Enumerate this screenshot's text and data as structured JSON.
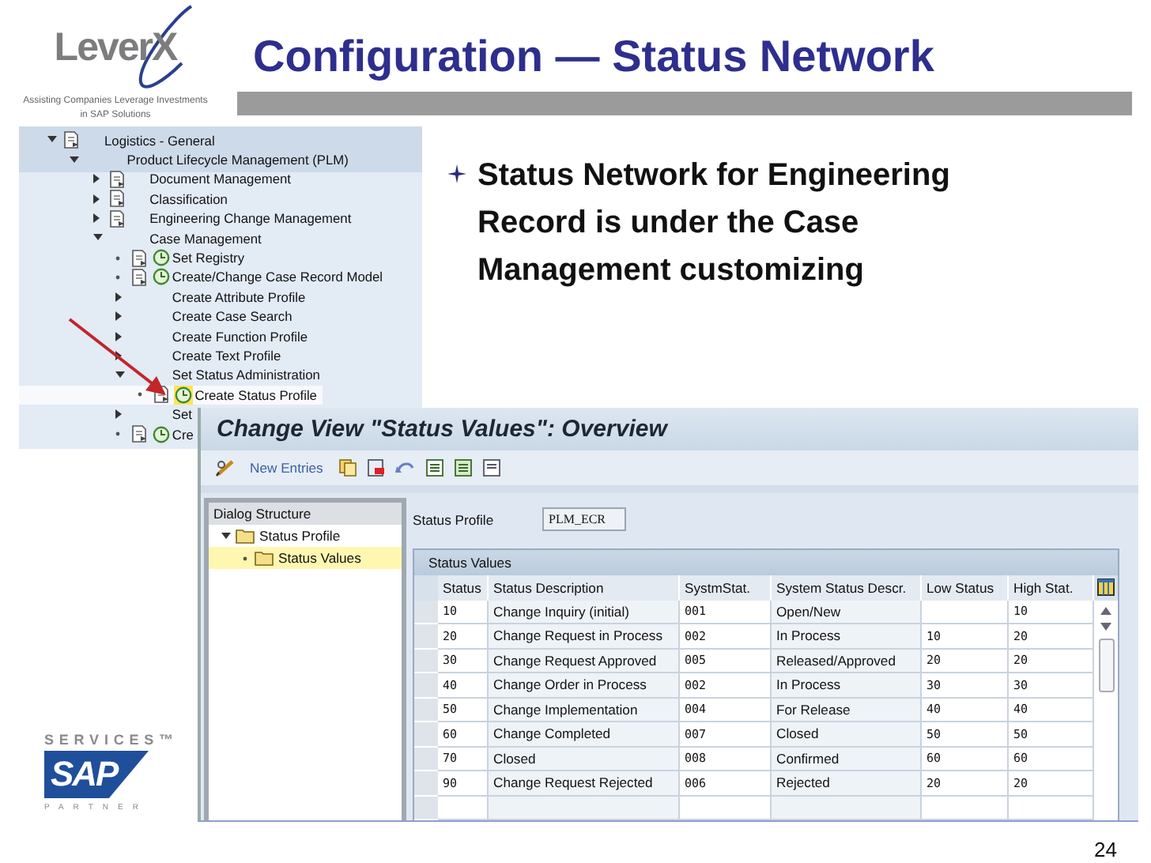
{
  "header": {
    "logo_text": "LeverX",
    "tagline": "Assisting Companies Leverage Investments in SAP Solutions",
    "title": "Configuration — Status Network"
  },
  "img_tree": {
    "items": [
      {
        "label": "Logistics - General",
        "kind": "doc",
        "expanded": true,
        "selected": false,
        "children": [
          {
            "label": "Product Lifecycle Management (PLM)",
            "kind": "plain",
            "expanded": true,
            "selected": false,
            "children": [
              {
                "label": "Document Management",
                "kind": "doc",
                "expanded": false,
                "selected": false
              },
              {
                "label": "Classification",
                "kind": "doc",
                "expanded": false,
                "selected": false
              },
              {
                "label": "Engineering Change Management",
                "kind": "doc",
                "expanded": false,
                "selected": false
              },
              {
                "label": "Case Management",
                "kind": "plain",
                "expanded": true,
                "selected": false,
                "children": [
                  {
                    "label": "Set Registry",
                    "kind": "doc_exec",
                    "expanded": false,
                    "selected": false
                  },
                  {
                    "label": "Create/Change Case Record Model",
                    "kind": "doc_exec",
                    "expanded": false,
                    "selected": false
                  },
                  {
                    "label": "Create Attribute Profile",
                    "kind": "plain",
                    "expanded": false,
                    "selected": false
                  },
                  {
                    "label": "Create Case Search",
                    "kind": "plain",
                    "expanded": false,
                    "selected": false
                  },
                  {
                    "label": "Create Function Profile",
                    "kind": "plain",
                    "expanded": false,
                    "selected": false
                  },
                  {
                    "label": "Create Text Profile",
                    "kind": "plain",
                    "expanded": false,
                    "selected": false
                  },
                  {
                    "label": "Set Status Administration",
                    "kind": "plain",
                    "expanded": true,
                    "selected": false,
                    "children": [
                      {
                        "label": "Create Status Profile",
                        "kind": "doc_exec",
                        "expanded": false,
                        "selected": true
                      }
                    ]
                  },
                  {
                    "label": "Set",
                    "kind": "plain",
                    "expanded": false,
                    "selected": false
                  },
                  {
                    "label": "Cre",
                    "kind": "doc_exec",
                    "expanded": false,
                    "selected": false
                  }
                ]
              }
            ]
          }
        ]
      }
    ]
  },
  "bullets": [
    "Status Network for Engineering Record is under the Case Management customizing"
  ],
  "sap_window": {
    "title": "Change View \"Status Values\": Overview",
    "toolbar": {
      "new_entries": "New Entries"
    },
    "dialog_structure": {
      "heading": "Dialog Structure",
      "items": [
        {
          "label": "Status Profile",
          "expanded": true,
          "selected": false,
          "children": [
            {
              "label": "Status Values",
              "expanded": false,
              "selected": true
            }
          ]
        }
      ]
    },
    "status_profile": {
      "label": "Status Profile",
      "value": "PLM_ECR"
    },
    "table": {
      "title": "Status Values",
      "columns": [
        "Status",
        "Status Description",
        "SystmStat.",
        "System Status Descr.",
        "Low Status",
        "High Stat."
      ],
      "rows": [
        {
          "status": "10",
          "description": "Change Inquiry (initial)",
          "system_status": "001",
          "system_status_descr": "Open/New",
          "high_status": "10"
        },
        {
          "status": "20",
          "description": "Change Request in Process",
          "system_status": "002",
          "system_status_descr": "In Process",
          "low_status": "10",
          "high_status": "20"
        },
        {
          "status": "30",
          "description": "Change Request Approved",
          "system_status": "005",
          "system_status_descr": "Released/Approved",
          "low_status": "20",
          "high_status": "20"
        },
        {
          "status": "40",
          "description": "Change Order in Process",
          "system_status": "002",
          "system_status_descr": "In Process",
          "low_status": "30",
          "high_status": "30"
        },
        {
          "status": "50",
          "description": "Change Implementation",
          "system_status": "004",
          "system_status_descr": "For Release",
          "low_status": "40",
          "high_status": "40"
        },
        {
          "status": "60",
          "description": "Change Completed",
          "system_status": "007",
          "system_status_descr": "Closed",
          "low_status": "50",
          "high_status": "50"
        },
        {
          "status": "70",
          "description": "Closed",
          "system_status": "008",
          "system_status_descr": "Confirmed",
          "low_status": "60",
          "high_status": "60"
        },
        {
          "status": "90",
          "description": "Change Request Rejected",
          "system_status": "006",
          "system_status_descr": "Rejected",
          "low_status": "20",
          "high_status": "20"
        }
      ]
    }
  },
  "footer": {
    "partner_logo": {
      "top": "SERVICES™",
      "mark": "SAP",
      "bottom": "PARTNER"
    },
    "page_number": "24"
  }
}
